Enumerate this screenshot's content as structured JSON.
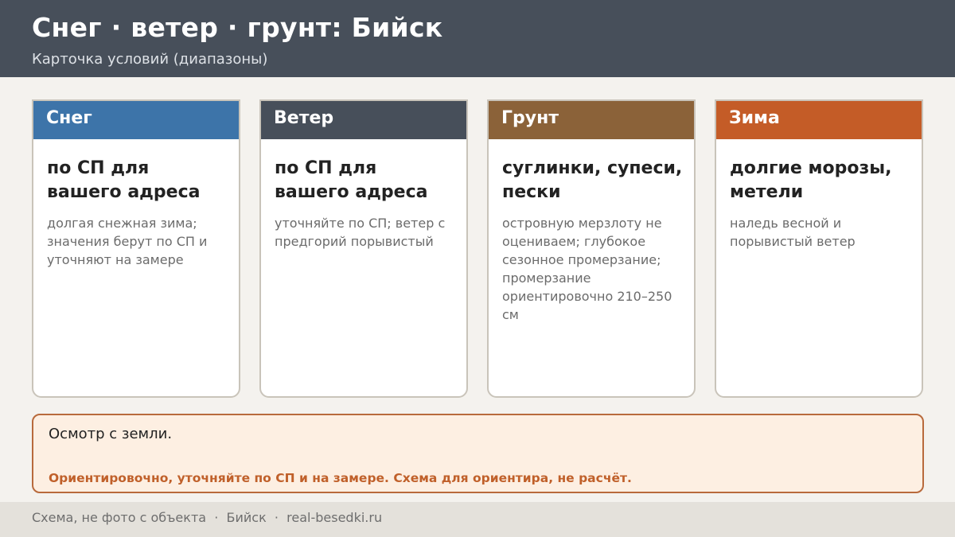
{
  "header": {
    "title": "Снег · ветер · грунт: Бийск",
    "subtitle": "Карточка условий (диапазоны)"
  },
  "cards": [
    {
      "heading": "Снег",
      "color": "#3d74a9",
      "value": "по СП для вашего адреса",
      "note": "долгая снежная зима; значения берут по СП и уточняют на замере"
    },
    {
      "heading": "Ветер",
      "color": "#474f5a",
      "value": "по СП для вашего адреса",
      "note": "уточняйте по СП; ветер с предгорий порывистый"
    },
    {
      "heading": "Грунт",
      "color": "#8b6239",
      "value": "суглинки, супеси, пески",
      "note": "островную мерзлоту не оцениваем; глубокое сезонное промерзание; промерзание ориентировочно 210–250 см"
    },
    {
      "heading": "Зима",
      "color": "#c45c27",
      "value": "долгие морозы, метели",
      "note": "наледь весной и порывистый ветер"
    }
  ],
  "note_box": {
    "main": "Осмотр с земли.",
    "warning": "Ориентировочно, уточняйте по СП и на замере. Схема для ориентира, не расчёт."
  },
  "footer": {
    "text": "Схема, не фото с объекта  ·  Бийск  ·  real-besedki.ru"
  }
}
